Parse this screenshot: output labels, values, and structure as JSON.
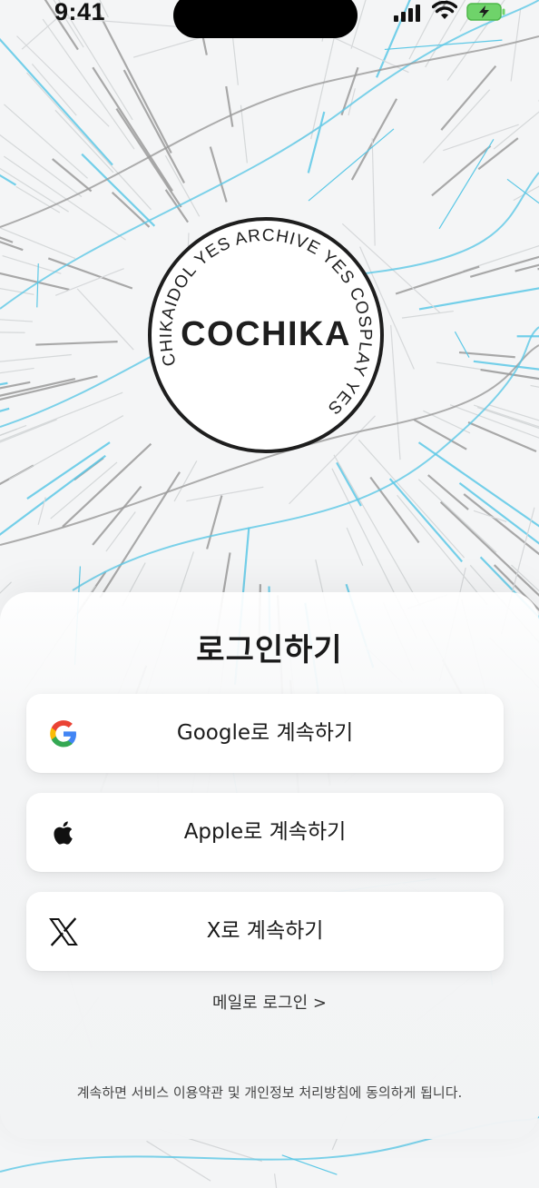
{
  "status_bar": {
    "time": "9:41"
  },
  "logo": {
    "center_text": "COCHIKA",
    "ring_words": [
      "YES",
      "ARCHIVE",
      "YES",
      "COSPLAY",
      "YES",
      "CHIKAIDOL"
    ]
  },
  "login": {
    "title": "로그인하기",
    "buttons": [
      {
        "icon": "google-icon",
        "label": "Google로 계속하기"
      },
      {
        "icon": "apple-icon",
        "label": "Apple로 계속하기"
      },
      {
        "icon": "x-icon",
        "label": "X로 계속하기"
      }
    ],
    "email_link": "메일로 로그인  >",
    "terms": "계속하면 서비스 이용약관 및 개인정보 처리방침에 동의하게 됩니다."
  },
  "colors": {
    "accent_cyan": "#5cc8e6",
    "line_gray": "#9a9a9a",
    "text_dark": "#1a1a1a"
  }
}
